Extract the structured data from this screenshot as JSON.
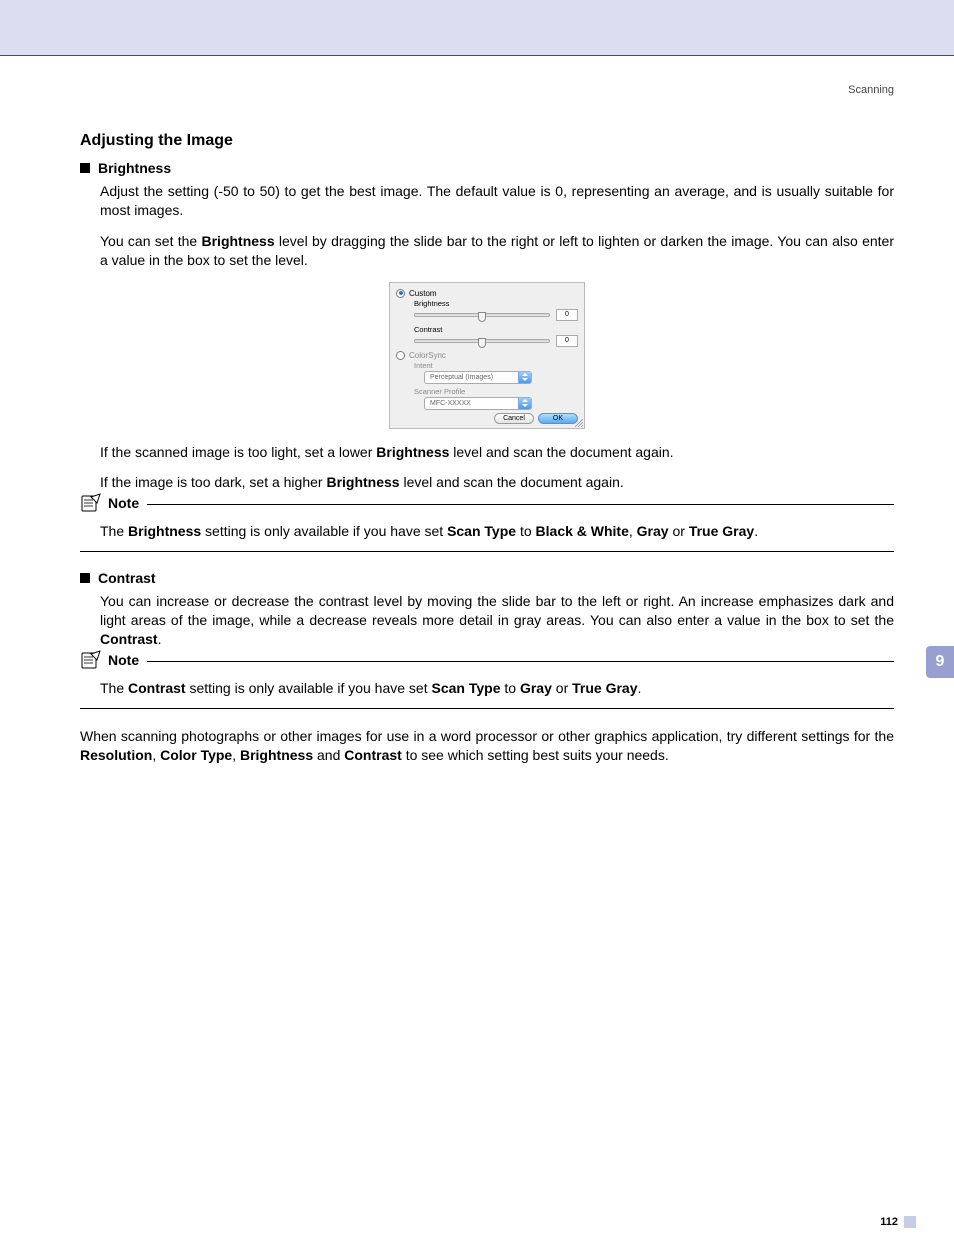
{
  "runningHead": "Scanning",
  "sectionHeading": "Adjusting the Image",
  "brightness": {
    "label": "Brightness",
    "p1_a": "Adjust the setting (-50 to 50) to get the best image. The default value is 0, representing an average, and is usually suitable for most images.",
    "p2_pre": "You can set the ",
    "p2_b": "Brightness",
    "p2_post": " level by dragging the slide bar to the right or left to lighten or darken the image. You can also enter a value in the box to set the level.",
    "p3_pre": "If the scanned image is too light, set a lower ",
    "p3_b": "Brightness",
    "p3_post": " level and scan the document again.",
    "p4_pre": "If the image is too dark, set a higher ",
    "p4_b": "Brightness",
    "p4_post": " level and scan the document again."
  },
  "note1": {
    "label": "Note",
    "a": "The ",
    "b1": "Brightness",
    "c": " setting is only available if you have set ",
    "b2": "Scan Type",
    "d": " to ",
    "b3": "Black & White",
    "e": ", ",
    "b4": "Gray",
    "f": " or ",
    "b5": "True Gray",
    "g": "."
  },
  "contrast": {
    "label": "Contrast",
    "p1_a": "You can increase or decrease the contrast level by moving the slide bar to the left or right. An increase emphasizes dark and light areas of the image, while a decrease reveals more detail in gray areas. You can also enter a value in the box to set the ",
    "p1_b": "Contrast",
    "p1_c": "."
  },
  "note2": {
    "label": "Note",
    "a": "The ",
    "b1": "Contrast",
    "c": " setting is only available if you have set ",
    "b2": "Scan Type",
    "d": " to ",
    "b3": "Gray",
    "e": " or ",
    "b4": "True Gray",
    "f": "."
  },
  "closing": {
    "a": "When scanning photographs or other images for use in a word processor or other graphics application, try different settings for the ",
    "b1": "Resolution",
    "c": ", ",
    "b2": "Color Type",
    "d": ", ",
    "b3": "Brightness",
    "e": " and ",
    "b4": "Contrast",
    "f": " to see which setting best suits your needs."
  },
  "dialog": {
    "custom": "Custom",
    "brightness": "Brightness",
    "contrast": "Contrast",
    "brightnessVal": "0",
    "contrastVal": "0",
    "colorsync": "ColorSync",
    "intent": "Intent",
    "intentVal": "Perceptual (Images)",
    "scannerProfile": "Scanner Profile",
    "scannerVal": "MFC-XXXXX",
    "cancel": "Cancel",
    "ok": "OK"
  },
  "sidetab": "9",
  "pageNumber": "112"
}
